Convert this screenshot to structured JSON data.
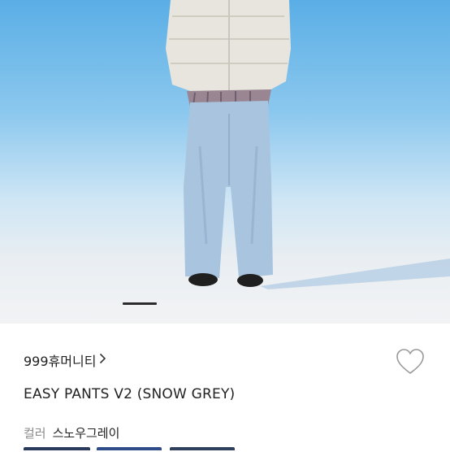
{
  "product": {
    "brand": "999휴머니티",
    "title": "EASY PANTS V2 (SNOW GREY)",
    "color_label": "컬러",
    "color_value": "스노우그레이"
  },
  "gallery": {
    "current_index": 1
  },
  "icons": {
    "brand_chevron": "chevron-right-icon",
    "wishlist": "heart-outline-icon"
  },
  "colors": {
    "sky": "#6bb6ea",
    "snow": "#eef0f2",
    "pants": "#a9c3dc",
    "jacket": "#e8e6df",
    "text": "#222222",
    "muted": "#8a8a8a"
  }
}
